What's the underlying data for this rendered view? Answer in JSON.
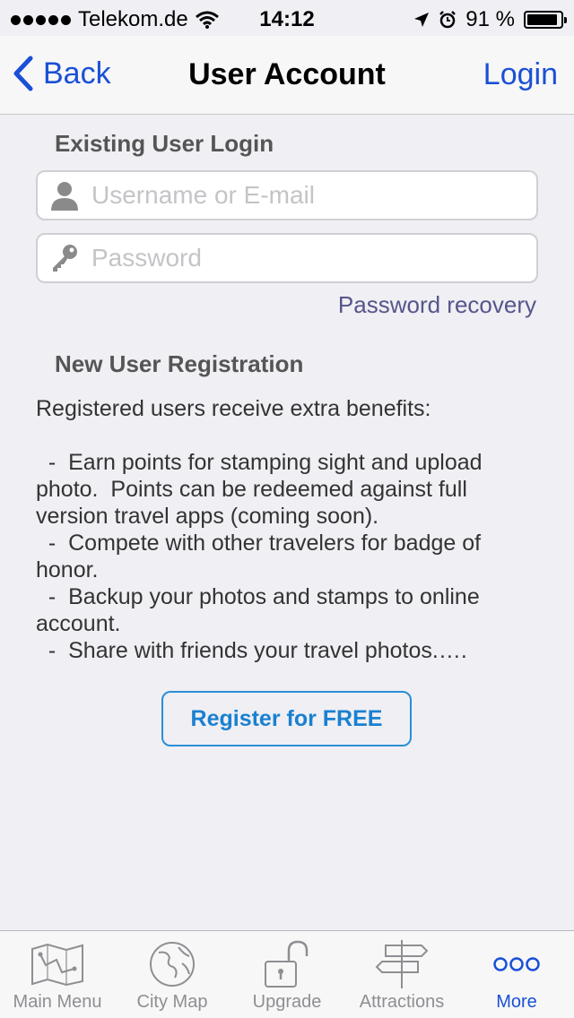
{
  "status_bar": {
    "carrier": "Telekom.de",
    "time": "14:12",
    "battery": "91 %",
    "battery_level": 0.91
  },
  "navbar": {
    "back_label": "Back",
    "title": "User Account",
    "login_label": "Login"
  },
  "login": {
    "heading": "Existing User Login",
    "username_placeholder": "Username or E-mail",
    "password_placeholder": "Password",
    "recovery_label": "Password recovery"
  },
  "registration": {
    "heading": "New User Registration",
    "intro": "Registered users receive extra benefits:",
    "benefits": [
      "  -  Earn points for stamping sight and upload photo.  Points can be redeemed against full version travel apps (coming soon).",
      "  -  Compete with other travelers for badge of honor.",
      "  -  Backup your photos and stamps to online account.",
      "  -  Share with friends your travel photos.…."
    ],
    "register_label": "Register for FREE"
  },
  "tabbar": {
    "items": [
      {
        "label": "Main Menu",
        "icon": "map-icon"
      },
      {
        "label": "City Map",
        "icon": "globe-icon"
      },
      {
        "label": "Upgrade",
        "icon": "unlock-icon"
      },
      {
        "label": "Attractions",
        "icon": "signpost-icon"
      },
      {
        "label": "More",
        "icon": "more-icon"
      }
    ],
    "active_index": 4
  },
  "colors": {
    "accent": "#1a50d6",
    "register": "#1a80d0",
    "recovery": "#56558a"
  }
}
